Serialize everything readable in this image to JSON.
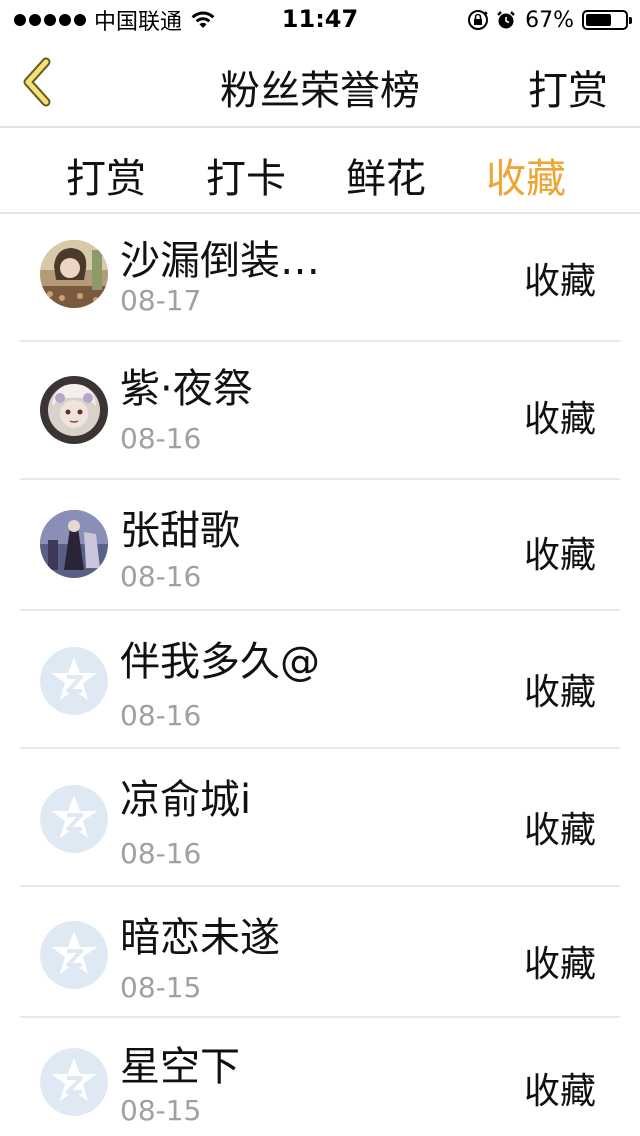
{
  "status_bar": {
    "carrier": "中国联通",
    "time": "11:47",
    "battery": "67%",
    "battery_level": 0.67,
    "icons": [
      "signal-dots",
      "wifi-icon",
      "orientation-lock-icon",
      "alarm-icon",
      "battery-icon"
    ]
  },
  "nav": {
    "back_icon": "chevron-left-icon",
    "title": "粉丝荣誉榜",
    "action": "打赏",
    "accent": "#eda534"
  },
  "tabs": [
    {
      "label": "打赏",
      "active": false
    },
    {
      "label": "打卡",
      "active": false
    },
    {
      "label": "鲜花",
      "active": false
    },
    {
      "label": "收藏",
      "active": true
    }
  ],
  "rows": [
    {
      "name": "沙漏倒装…",
      "date": "08-17",
      "action": "收藏",
      "avatar": "photo-avatar"
    },
    {
      "name": "紫·夜祭",
      "date": "08-16",
      "action": "收藏",
      "avatar": "photo-avatar"
    },
    {
      "name": "张甜歌",
      "date": "08-16",
      "action": "收藏",
      "avatar": "photo-avatar"
    },
    {
      "name": "伴我多久@",
      "date": "08-16",
      "action": "收藏",
      "avatar": "default-avatar-icon"
    },
    {
      "name": "凉俞城i",
      "date": "08-16",
      "action": "收藏",
      "avatar": "default-avatar-icon"
    },
    {
      "name": "暗恋未遂",
      "date": "08-15",
      "action": "收藏",
      "avatar": "default-avatar-icon"
    },
    {
      "name": "星空下",
      "date": "08-15",
      "action": "收藏",
      "avatar": "default-avatar-icon"
    }
  ]
}
